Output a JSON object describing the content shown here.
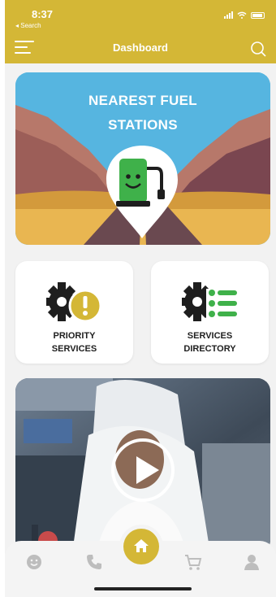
{
  "status_bar": {
    "time": "8:37",
    "back_label": "◂ Search"
  },
  "header": {
    "title": "Dashboard",
    "menu_icon": "hamburger-menu-icon",
    "search_icon": "search-icon"
  },
  "fuel_card": {
    "title_line1": "NEAREST FUEL",
    "title_line2": "STATIONS",
    "icon": "fuel-pump-smiley-icon"
  },
  "tiles": [
    {
      "label": "PRIORITY\nSERVICES",
      "icon": "gear-exclamation-icon"
    },
    {
      "label": "SERVICES\nDIRECTORY",
      "icon": "gear-list-icon"
    }
  ],
  "video": {
    "icon": "play-icon"
  },
  "bottom_nav": [
    {
      "icon": "smiley-icon"
    },
    {
      "icon": "phone-icon"
    },
    {
      "icon": "home-icon"
    },
    {
      "icon": "cart-icon"
    },
    {
      "icon": "profile-icon"
    }
  ],
  "colors": {
    "brand": "#d4b736",
    "sky": "#56b5e0",
    "fuel_green": "#3fb14a",
    "icon_dark": "#1e1e1e"
  }
}
